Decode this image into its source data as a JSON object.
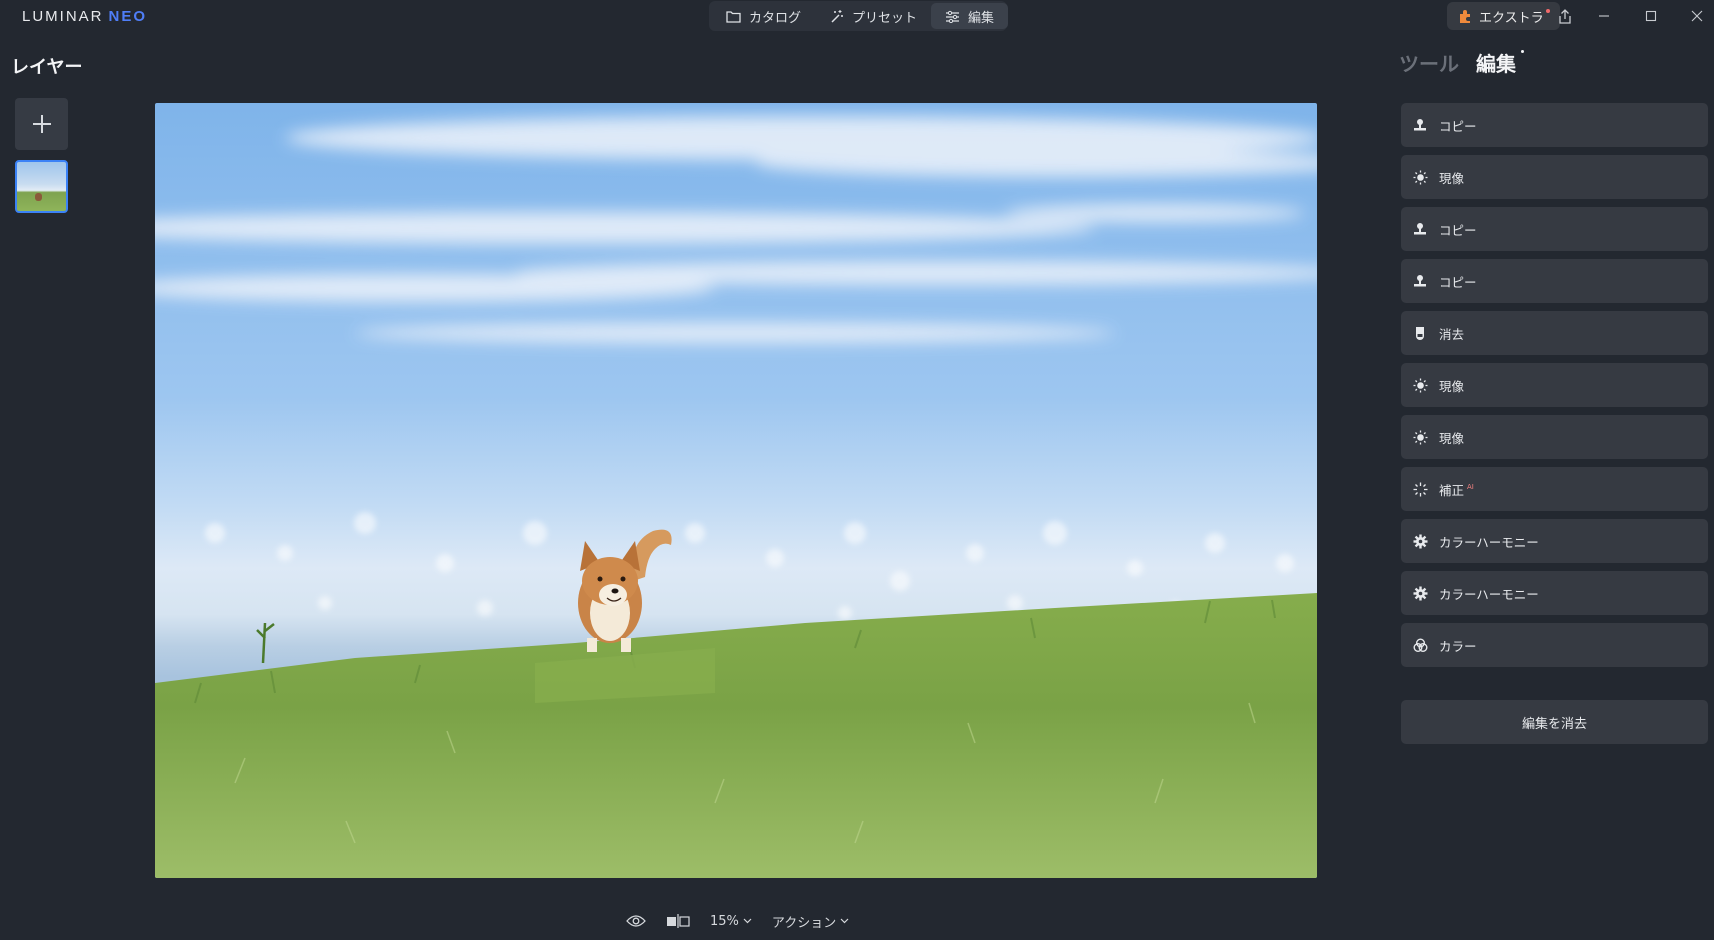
{
  "app": {
    "logo_main": "LUMINAR",
    "logo_accent": "NEO"
  },
  "modes": [
    {
      "label": "カタログ",
      "icon": "folder-icon"
    },
    {
      "label": "プリセット",
      "icon": "magic-wand-icon"
    },
    {
      "label": "編集",
      "icon": "sliders-icon",
      "active": true
    }
  ],
  "extras": {
    "label": "エクストラ",
    "icon": "puzzle-icon"
  },
  "layers": {
    "title": "レイヤー"
  },
  "bottom_bar": {
    "zoom": "15%",
    "actions": "アクション"
  },
  "right_panel": {
    "tabs": [
      {
        "label": "ツール",
        "active": false
      },
      {
        "label": "編集",
        "active": true
      }
    ],
    "edits": [
      {
        "label": "コピー",
        "icon": "stamp-icon"
      },
      {
        "label": "現像",
        "icon": "sun-icon"
      },
      {
        "label": "コピー",
        "icon": "stamp-icon"
      },
      {
        "label": "コピー",
        "icon": "stamp-icon"
      },
      {
        "label": "消去",
        "icon": "eraser-icon"
      },
      {
        "label": "現像",
        "icon": "sun-icon"
      },
      {
        "label": "現像",
        "icon": "sun-icon"
      },
      {
        "label": "補正",
        "badge": "AI",
        "icon": "sparkle-icon"
      },
      {
        "label": "カラーハーモニー",
        "icon": "gear-icon"
      },
      {
        "label": "カラーハーモニー",
        "icon": "gear-icon"
      },
      {
        "label": "カラー",
        "icon": "color-circles-icon"
      }
    ],
    "clear_button": "編集を消去"
  },
  "colors": {
    "background": "#232830",
    "accent": "#3b82f6",
    "panel_item": "#363a42"
  }
}
